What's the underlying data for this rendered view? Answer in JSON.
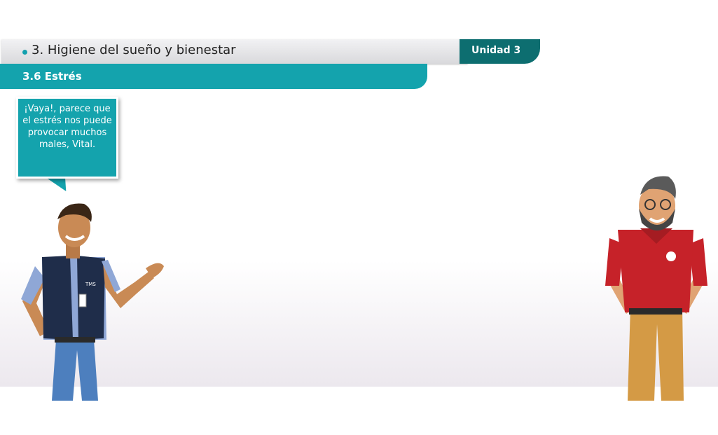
{
  "unit": {
    "title": "3. Higiene del sueño y bienestar",
    "badge": "Unidad 3"
  },
  "section": {
    "title": "3.6 Estrés"
  },
  "speech_bubble": {
    "text": "¡Vaya!, parece que el estrés nos puede provocar muchos males, Vital."
  },
  "left_character": {
    "vest_logo": "TMS"
  },
  "colors": {
    "teal": "#14a3ad",
    "dark_teal": "#0d6e70",
    "red_shirt": "#c62229",
    "khaki": "#d49a45",
    "navy_vest": "#1f2d4a"
  }
}
